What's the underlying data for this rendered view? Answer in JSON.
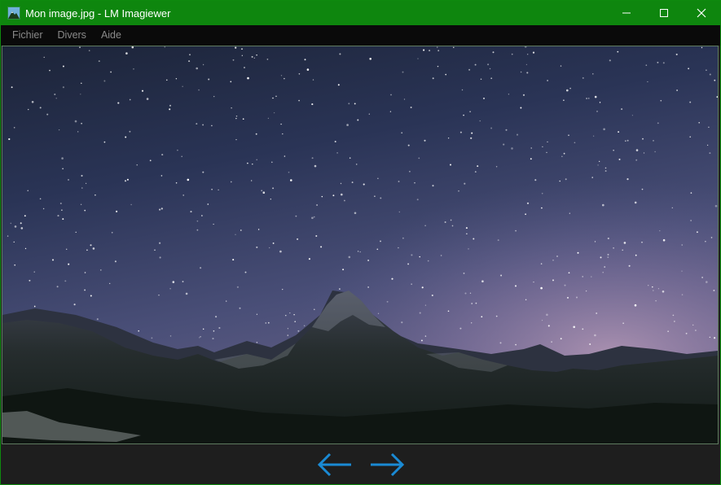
{
  "window": {
    "title": "Mon image.jpg - LM Imagiewer",
    "title_color": "#0e860e",
    "icons": [
      "app-icon",
      "minimize-icon",
      "maximize-icon",
      "close-icon"
    ]
  },
  "menu": {
    "items": [
      {
        "label": "Fichier"
      },
      {
        "label": "Divers"
      },
      {
        "label": "Aide"
      }
    ]
  },
  "viewer": {
    "image_description_icon": "starry-mountain-photo"
  },
  "navigation": {
    "previous_icon": "arrow-left-icon",
    "next_icon": "arrow-right-icon",
    "arrow_color": "#1a8ad4"
  }
}
